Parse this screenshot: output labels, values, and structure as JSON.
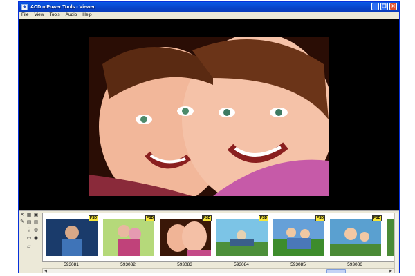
{
  "window": {
    "title": "ACD mPower Tools - Viewer",
    "controls": [
      "minimize",
      "restore",
      "close"
    ]
  },
  "menu": [
    "File",
    "View",
    "Tools",
    "Audio",
    "Help"
  ],
  "thumbnails": [
    {
      "label": "593081",
      "badge": "PSD",
      "colors": [
        "#1a3b6b",
        "#d8a888",
        "#3f74b8"
      ]
    },
    {
      "label": "593082",
      "badge": "PSD",
      "colors": [
        "#b5d97a",
        "#e59ab1",
        "#c0427a"
      ]
    },
    {
      "label": "593083",
      "badge": "PSD",
      "colors": [
        "#3a1708",
        "#f0b496",
        "#c44a88"
      ]
    },
    {
      "label": "593084",
      "badge": "PSD",
      "colors": [
        "#7cc4e6",
        "#4c8f3a",
        "#e6d2b2"
      ]
    },
    {
      "label": "593085",
      "badge": "PSD",
      "colors": [
        "#3d8c2c",
        "#f0c8a2",
        "#66a0d8"
      ]
    },
    {
      "label": "593086",
      "badge": "PSD",
      "colors": [
        "#5aa0d0",
        "#f2c8a4",
        "#4a8a36"
      ]
    }
  ],
  "icons": {
    "close": "close-icon",
    "pin": "pin-icon",
    "tools": [
      "grid-view-icon",
      "thumbnail-icon",
      "folder-icon",
      "image-icon",
      "search-icon",
      "globe-icon",
      "open-folder-icon",
      "open-icon",
      "web-icon"
    ]
  }
}
